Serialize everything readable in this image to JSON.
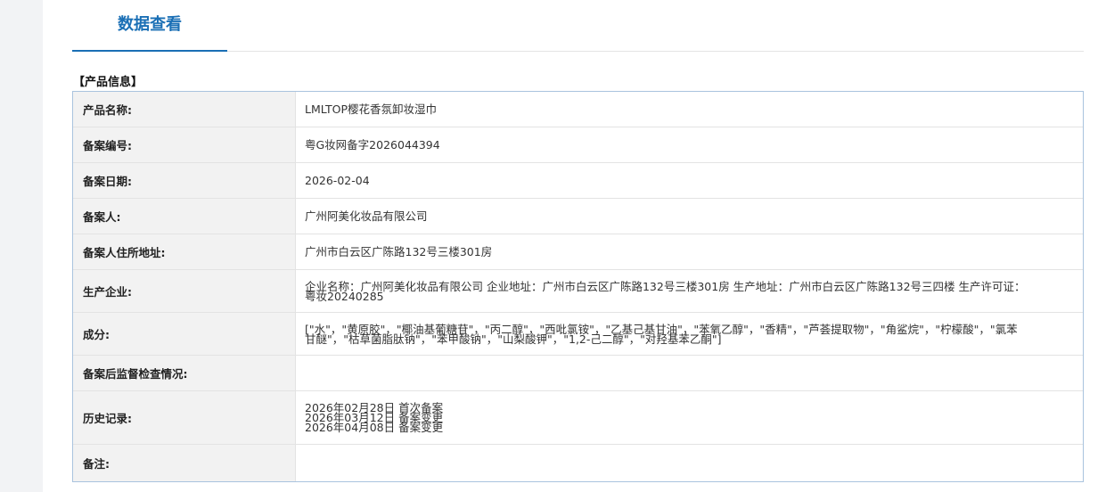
{
  "tab": {
    "label": "数据查看"
  },
  "section": {
    "title": "【产品信息】"
  },
  "rows": {
    "product_name": {
      "label": "产品名称:",
      "value": "LMLTOP樱花香氛卸妆湿巾"
    },
    "record_number": {
      "label": "备案编号:",
      "value": "粤G妆网备字2026044394"
    },
    "record_date": {
      "label": "备案日期:",
      "value": "2026-02-04"
    },
    "registrant": {
      "label": "备案人:",
      "value": "广州阿美化妆品有限公司"
    },
    "registrant_address": {
      "label": "备案人住所地址:",
      "value": "广州市白云区广陈路132号三楼301房"
    },
    "manufacturer": {
      "label": "生产企业:",
      "value": "企业名称：广州阿美化妆品有限公司 企业地址：广州市白云区广陈路132号三楼301房 生产地址：广州市白云区广陈路132号三四楼 生产许可证：粤妆20240285"
    },
    "ingredients": {
      "label": "成分:",
      "value": "[\"水\"，\"黄原胶\"，\"椰油基葡糖苷\"，\"丙二醇\"，\"西吡氯铵\"，\"乙基己基甘油\"，\"苯氧乙醇\"，\"香精\"，\"芦荟提取物\"，\"角鲨烷\"，\"柠檬酸\"，\"氯苯甘醚\"，\"枯草菌脂肽钠\"，\"苯甲酸钠\"，\"山梨酸钾\"，\"1,2-己二醇\"，\"对羟基苯乙酮\"]"
    },
    "inspection": {
      "label": "备案后监督检查情况:",
      "value": ""
    },
    "history": {
      "label": "历史记录:",
      "entries": [
        "2026年02月28日 首次备案",
        "2026年03月12日 备案变更",
        "2026年04月08日 备案变更"
      ]
    },
    "remarks": {
      "label": "备注:",
      "value": ""
    }
  }
}
